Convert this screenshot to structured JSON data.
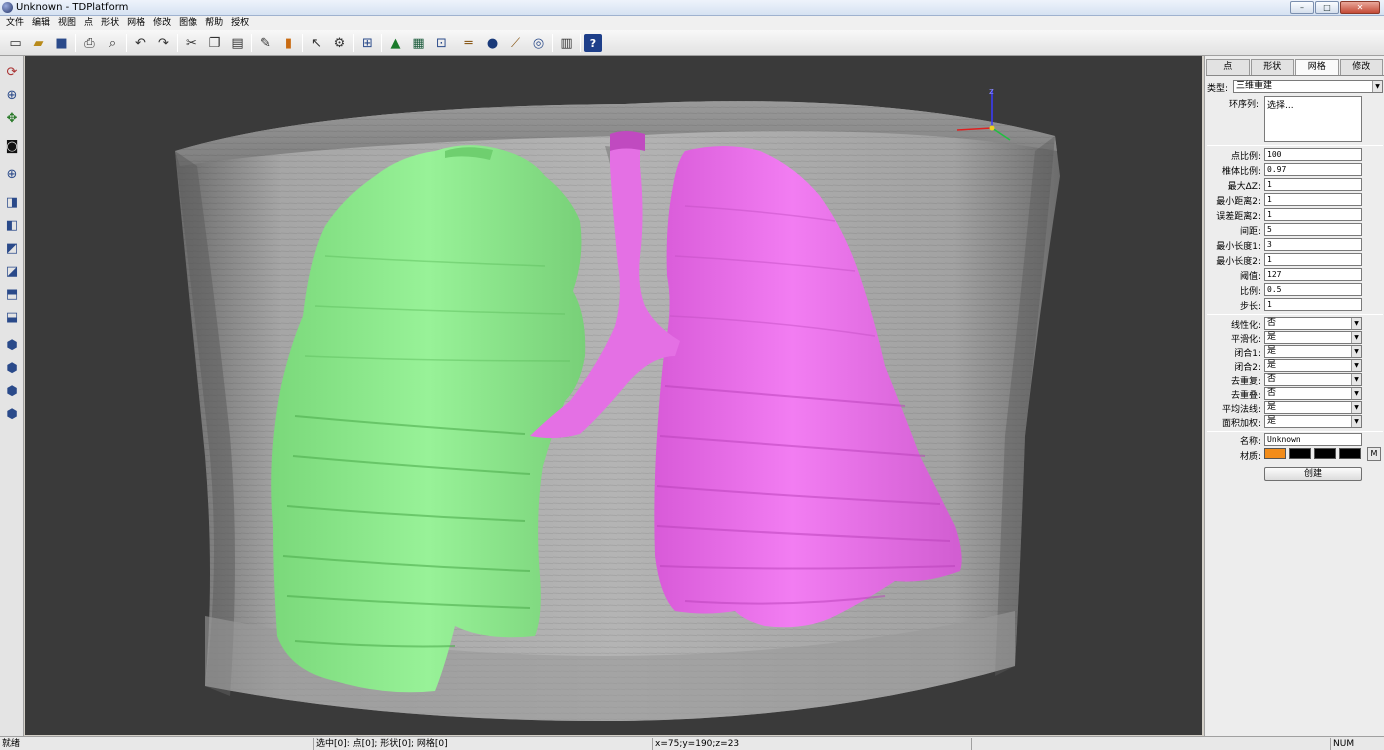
{
  "window": {
    "title": "Unknown - TDPlatform",
    "minimize": "–",
    "maximize": "□",
    "close": "✕"
  },
  "menu": [
    "文件",
    "编辑",
    "视图",
    "点",
    "形状",
    "网格",
    "修改",
    "图像",
    "帮助",
    "授权"
  ],
  "toolbar_icons": [
    "new-file",
    "open-folder",
    "save",
    "print",
    "print-preview",
    "undo",
    "redo",
    "cut",
    "copy",
    "paste",
    "pen",
    "bucket",
    "select-arrow",
    "settings-tool",
    "frame-grid",
    "render-scene",
    "color-map",
    "chart-panel",
    "measure-ruler",
    "sphere",
    "brush",
    "target",
    "filmstrip",
    "help"
  ],
  "left_tools": [
    "rotate",
    "zoom-in-out",
    "pan",
    "camera",
    "zoom-window",
    "view-front",
    "view-back",
    "view-left",
    "view-right",
    "view-top",
    "view-bottom",
    "iso-view-1",
    "iso-view-2",
    "iso-view-3",
    "iso-view-4"
  ],
  "viewport": {
    "axis_label": "z",
    "colors": {
      "background": "#3a3a3a",
      "body": "#a8a8a8",
      "left_lung": "#8ef08e",
      "right_lung": "#ef72ef"
    }
  },
  "panel": {
    "tabs": [
      "点",
      "形状",
      "网格",
      "修改"
    ],
    "active_tab": "网格",
    "type_label": "类型:",
    "type_value": "三维重建",
    "ring_label": "环序列:",
    "ring_value": "选择...",
    "params": [
      {
        "label": "点比例:",
        "value": "100"
      },
      {
        "label": "椎体比例:",
        "value": "0.97"
      },
      {
        "label": "最大ΔZ:",
        "value": "1"
      },
      {
        "label": "最小距离2:",
        "value": "1"
      },
      {
        "label": "误差距离2:",
        "value": "1"
      },
      {
        "label": "间距:",
        "value": "5"
      },
      {
        "label": "最小长度1:",
        "value": "3"
      },
      {
        "label": "最小长度2:",
        "value": "1"
      },
      {
        "label": "阈值:",
        "value": "127"
      },
      {
        "label": "比例:",
        "value": "0.5"
      },
      {
        "label": "步长:",
        "value": "1"
      }
    ],
    "options": [
      {
        "label": "线性化:",
        "value": "否"
      },
      {
        "label": "平滑化:",
        "value": "是"
      },
      {
        "label": "闭合1:",
        "value": "是"
      },
      {
        "label": "闭合2:",
        "value": "是"
      },
      {
        "label": "去重复:",
        "value": "否"
      },
      {
        "label": "去重叠:",
        "value": "否"
      },
      {
        "label": "平均法线:",
        "value": "是"
      },
      {
        "label": "面积加权:",
        "value": "是"
      }
    ],
    "name_label": "名称:",
    "name_value": "Unknown",
    "material_label": "材质:",
    "material_colors": [
      "#f28c1a",
      "#000000",
      "#000000",
      "#000000"
    ],
    "material_button": "M",
    "create_button": "创建"
  },
  "status": {
    "ready": "就绪",
    "selection": "选中[0]: 点[0]; 形状[0]; 网格[0]",
    "coords": "x=75;y=190;z=23",
    "num": "NUM"
  }
}
